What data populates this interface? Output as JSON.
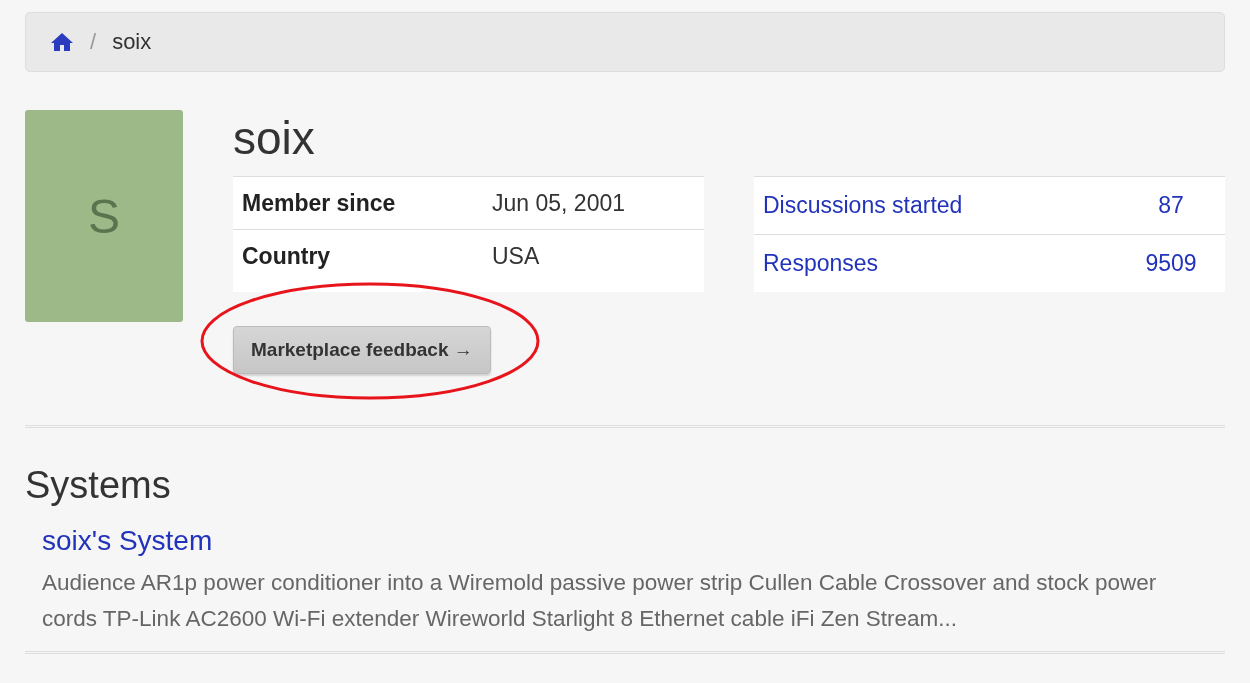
{
  "breadcrumb": {
    "items": [
      {
        "kind": "home"
      },
      {
        "kind": "text",
        "label": "soix"
      }
    ],
    "separator": "/"
  },
  "profile": {
    "avatar_letter": "S",
    "name": "soix",
    "details": [
      {
        "label": "Member since",
        "value": "Jun 05, 2001"
      },
      {
        "label": "Country",
        "value": "USA"
      }
    ],
    "stats": [
      {
        "label": "Discussions started",
        "value": "87"
      },
      {
        "label": "Responses",
        "value": "9509"
      }
    ],
    "feedback_button": {
      "label": "Marketplace feedback →",
      "highlighted": true
    }
  },
  "systems": {
    "heading": "Systems",
    "items": [
      {
        "title": "soix's System",
        "description": "Audience AR1p power conditioner into a Wiremold passive power strip Cullen Cable Crossover and stock power cords TP-Link AC2600 Wi-Fi extender Wireworld Starlight 8 Ethernet cable iFi Zen Stream..."
      }
    ]
  }
}
